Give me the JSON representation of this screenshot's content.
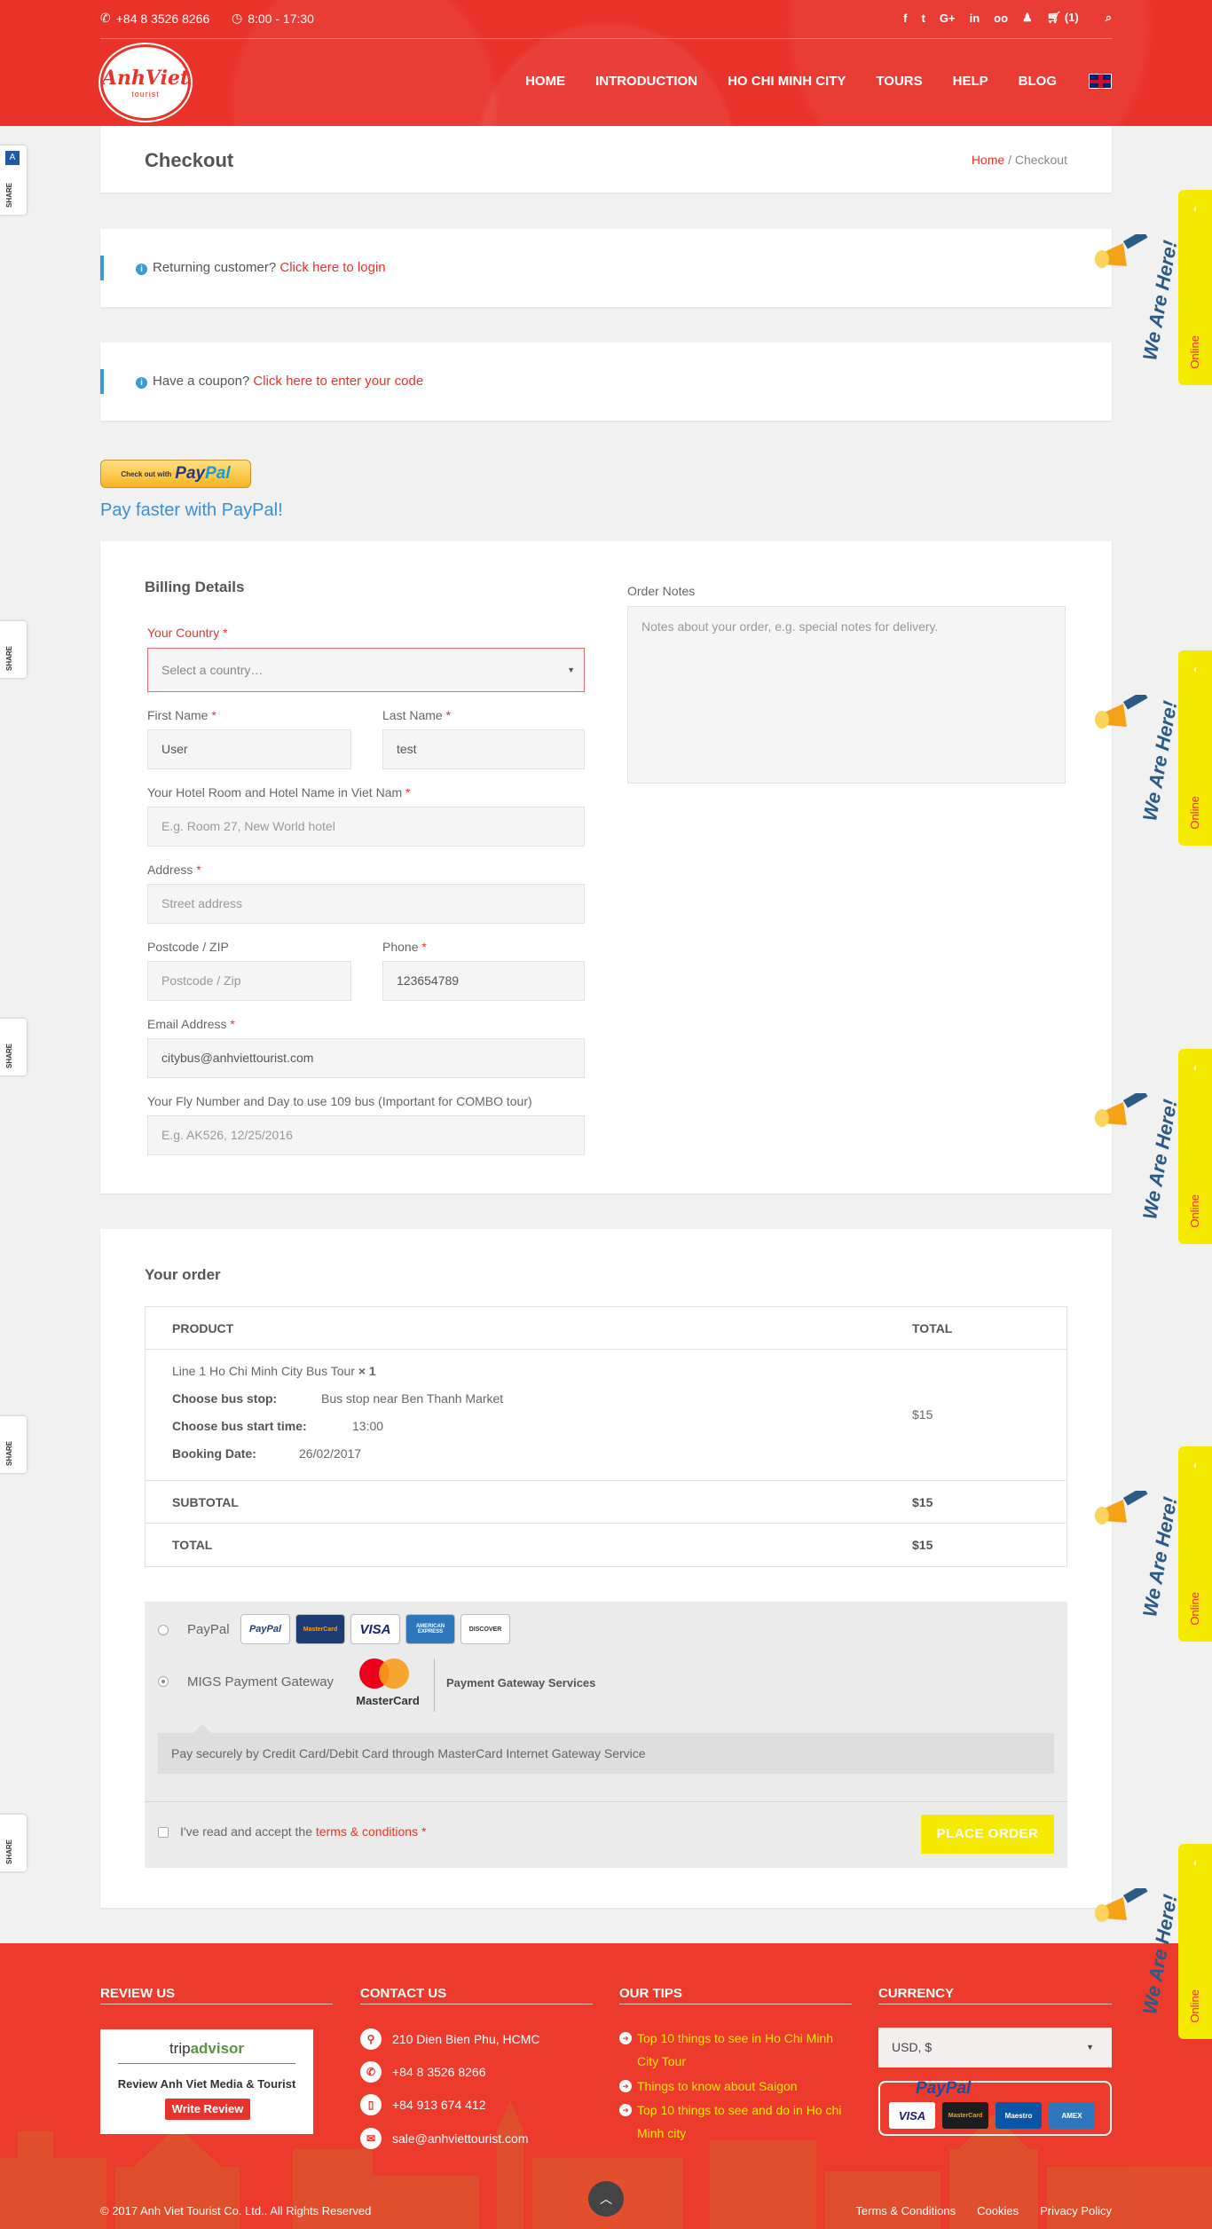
{
  "topbar": {
    "phone": "+84 8 3526 8266",
    "hours": "8:00 - 17:30",
    "cart": "(1)",
    "social": [
      "f",
      "t",
      "G+",
      "in",
      "oo"
    ]
  },
  "logo": {
    "text": "AnhViet",
    "sub": "tourist"
  },
  "nav": [
    "HOME",
    "INTRODUCTION",
    "HO CHI MINH CITY",
    "TOURS",
    "HELP",
    "BLOG"
  ],
  "page": {
    "title": "Checkout",
    "breadcrumb_home": "Home",
    "breadcrumb_current": "/ Checkout"
  },
  "notices": {
    "returning_text": "Returning customer?",
    "returning_link": "Click here to login",
    "coupon_text": "Have a coupon?",
    "coupon_link": "Click here to enter your code"
  },
  "paypal": {
    "checkout_small": "Check out with",
    "brand_a": "Pay",
    "brand_b": "Pal",
    "pay_faster": "Pay faster with PayPal!"
  },
  "billing": {
    "title": "Billing Details",
    "country_label": "Your Country",
    "country_placeholder": "Select a country…",
    "first_name_label": "First Name",
    "first_name_value": "User",
    "last_name_label": "Last Name",
    "last_name_value": "test",
    "hotel_label": "Your Hotel Room and Hotel Name in Viet Nam",
    "hotel_placeholder": "E.g. Room 27, New World hotel",
    "address_label": "Address",
    "address_placeholder": "Street address",
    "postcode_label": "Postcode / ZIP",
    "postcode_placeholder": "Postcode / Zip",
    "phone_label": "Phone",
    "phone_value": "123654789",
    "email_label": "Email Address",
    "email_value": "citybus@anhviettourist.com",
    "fly_label": "Your Fly Number and Day to use 109 bus (Important for COMBO tour)",
    "fly_placeholder": "E.g. AK526, 12/25/2016",
    "notes_label": "Order Notes",
    "notes_placeholder": "Notes about your order, e.g. special notes for delivery.",
    "required_mark": "*"
  },
  "order": {
    "title": "Your order",
    "col_product": "PRODUCT",
    "col_total": "TOTAL",
    "product_name": "Line 1 Ho Chi Minh City Bus Tour",
    "quantity": "× 1",
    "product_total": "$15",
    "meta": [
      {
        "key": "Choose bus stop:",
        "value": "Bus stop near Ben Thanh Market"
      },
      {
        "key": "Choose bus start time:",
        "value": "13:00"
      },
      {
        "key": "Booking Date:",
        "value": "26/02/2017"
      }
    ],
    "subtotal_label": "SUBTOTAL",
    "subtotal_value": "$15",
    "total_label": "TOTAL",
    "total_value": "$15"
  },
  "payment": {
    "paypal_label": "PayPal",
    "paypal_cards": [
      "PayPal",
      "MasterCard",
      "VISA",
      "AMERICAN EXPRESS",
      "DISCOVER"
    ],
    "migs_label": "MIGS Payment Gateway",
    "migs_logo_text": "MasterCard",
    "migs_service": "Payment Gateway Services",
    "description": "Pay securely by Credit Card/Debit Card through MasterCard Internet Gateway Service",
    "terms_text": "I've read and accept the",
    "terms_link": "terms & conditions",
    "terms_req": "*",
    "place_order": "PLACE ORDER"
  },
  "side": {
    "share_label": "SHARE",
    "online_label": "Online",
    "we_are_here": "We Are Here!"
  },
  "footer": {
    "review_title": "REVIEW US",
    "contact_title": "CONTACT US",
    "tips_title": "OUR TIPS",
    "currency_title": "CURRENCY",
    "trip_brand_a": "trip",
    "trip_brand_b": "advisor",
    "trip_review": "Review Anh Viet Media & Tourist",
    "trip_write": "Write Review",
    "contacts": [
      "210 Dien Bien Phu, HCMC",
      "+84 8 3526 8266",
      "+84 913 674 412",
      "sale@anhviettourist.com"
    ],
    "tips": [
      "Top 10 things to see in Ho Chi Minh City Tour",
      "Things to know about Saigon",
      "Top 10 things to see and do in Ho chi Minh city"
    ],
    "currency_value": "USD, $",
    "pay_brand": "PayPal",
    "pay_cards": [
      "VISA",
      "MasterCard",
      "Maestro",
      "AMEX"
    ],
    "copyright": "© 2017 Anh Viet Tourist Co. Ltd.. All Rights Reserved",
    "links": [
      "Terms & Conditions",
      "Cookies",
      "Privacy Policy"
    ]
  },
  "colors": {
    "brand_red": "#e8322a",
    "accent_yellow": "#f5ea00",
    "link_blue": "#3a8fd8"
  }
}
